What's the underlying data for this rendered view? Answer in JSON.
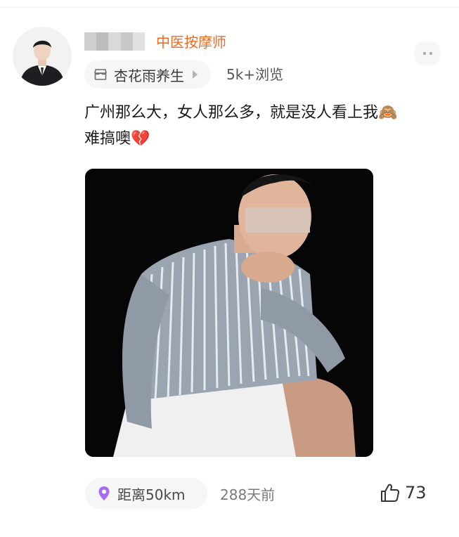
{
  "author": {
    "role": "中医按摩师"
  },
  "circle": {
    "name": "杏花雨养生"
  },
  "views": "5k+浏览",
  "post": {
    "line1": "广州那么大，女人那么多，就是没人看上我",
    "line1_emoji": "🙈",
    "line2": "难搞噢",
    "line2_emoji": "💔"
  },
  "footer": {
    "distance": "距离50km",
    "time": "288天前",
    "likes": "73"
  },
  "colors": {
    "accent": "#ef6a1f",
    "location_pin": "#a96bf0"
  },
  "icons": [
    "more-icon",
    "circle-icon",
    "chevron-right-icon",
    "location-pin-icon",
    "thumbs-up-icon"
  ]
}
